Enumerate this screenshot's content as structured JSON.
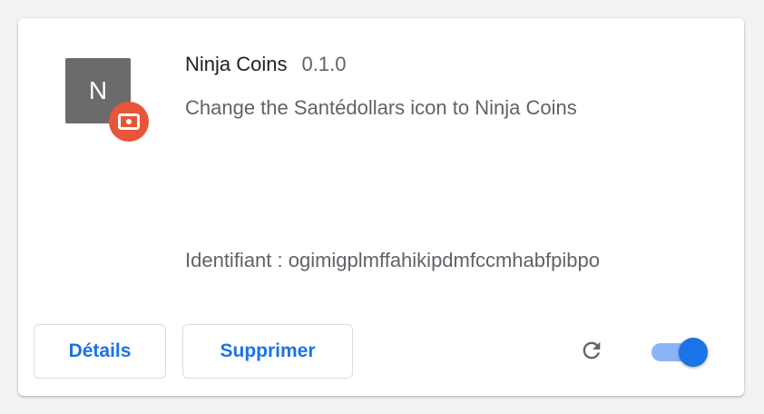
{
  "extension": {
    "icon_letter": "N",
    "name": "Ninja Coins",
    "version": "0.1.0",
    "description": "Change the Santédollars icon to Ninja Coins",
    "identifier_text": "Identifiant : ogimigplmffahikipdmfccmhabfpibpo"
  },
  "actions": {
    "details_label": "Détails",
    "remove_label": "Supprimer"
  },
  "toggle": {
    "enabled": true
  },
  "colors": {
    "accent": "#1a73e8",
    "toggle_track": "#8ab4f8",
    "badge": "#e8553a",
    "icon_bg": "#6b6b6b"
  },
  "icons": {
    "badge": "ticket-icon",
    "reload": "reload-icon"
  }
}
